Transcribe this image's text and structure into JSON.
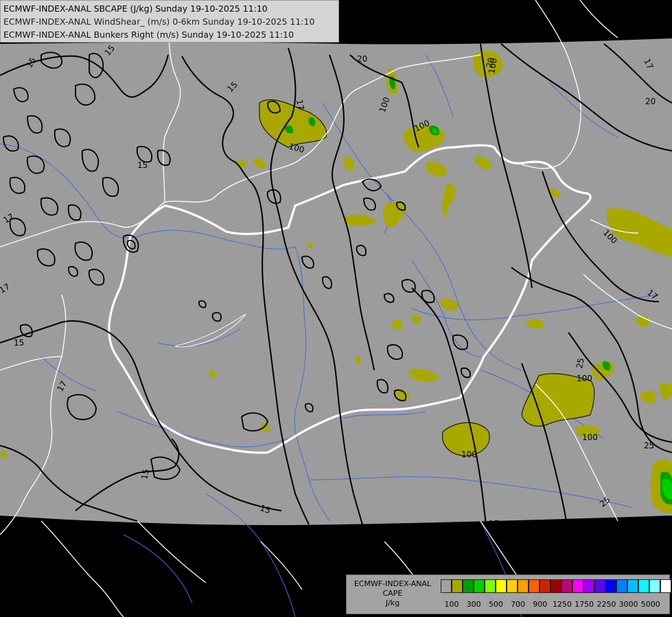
{
  "header": {
    "line1": "ECMWF-INDEX-ANAL SBCAPE (J/kg) Sunday 19-10-2025 11:10",
    "line2": "ECMWF-INDEX-ANAL WindShear_ (m/s) 0-6km Sunday 19-10-2025 11:10",
    "line3": "ECMWF-INDEX-ANAL Bunkers Right (m/s) Sunday 19-10-2025 11:10"
  },
  "legend": {
    "title_line1": "ECMWF-INDEX-ANAL",
    "title_line2": "CAPE",
    "unit": "J/kg",
    "colors": [
      "#a0a0a0",
      "#a8a800",
      "#00a000",
      "#00d000",
      "#80ff00",
      "#ffff00",
      "#ffd000",
      "#ffa000",
      "#ff6000",
      "#d02000",
      "#a00000",
      "#c00080",
      "#ff00ff",
      "#a000ff",
      "#6000ff",
      "#0000ff",
      "#0080ff",
      "#00c0ff",
      "#00ffff",
      "#80ffff",
      "#ffffff"
    ],
    "ticks": [
      "100",
      "300",
      "500",
      "700",
      "900",
      "1250",
      "1750",
      "2250",
      "3000",
      "5000"
    ]
  },
  "contour_labels": {
    "l15a": "15",
    "l15b": "15",
    "l15c": "15",
    "l15d": "15",
    "l15e": "15",
    "l15f": "15",
    "l17a": "17",
    "l17b": "17",
    "l17c": "17",
    "l17d": "17",
    "l17e": "17",
    "l17f": "17",
    "l17g": "17",
    "l20a": "20",
    "l20b": "20",
    "l20c": "20",
    "l25a": "25",
    "l25b": "25",
    "l25c": "25",
    "c100a": "100",
    "c100b": "100",
    "c100c": "100",
    "c100d": "100",
    "c100e": "100",
    "c100f": "100",
    "c100g": "100",
    "c100h": "100"
  },
  "colors": {
    "map_fill": "#9c9c9c",
    "outside": "#000000",
    "cape_low": "#a8a800",
    "cape_mid": "#00a000",
    "border": "#ffffff",
    "river": "#3a6fd8",
    "contour": "#000000"
  }
}
